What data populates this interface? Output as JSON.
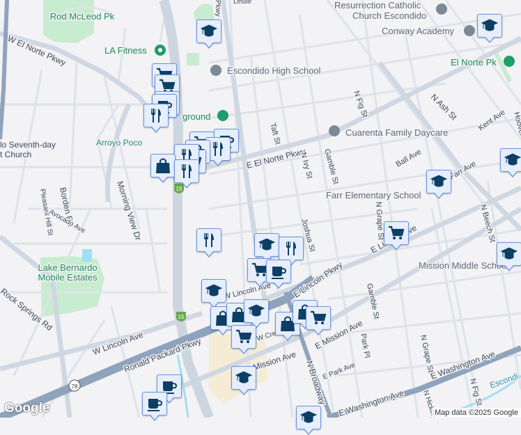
{
  "map": {
    "streets": {
      "w_el_norte": "W El Norte Pkwy",
      "e_el_norte": "E El Norte Pkwy",
      "morning_view": "Morning View Dr",
      "borden": "Borden Rd",
      "pleasant_hill": "Pleasant Hill St",
      "avocado": "Avocado Ave",
      "rock_springs": "Rock Springs Rd",
      "w_lincoln": "W Lincoln Ave",
      "w_lincoln2": "W Lincoln Ave",
      "e_lincoln_pkwy": "E Lincoln Pkwy",
      "e_lincoln_ave": "E Lincoln Ave",
      "ronald_packard": "Ronald Packard Pkwy",
      "mission": "Mission Ave",
      "e_mission": "E Mission Ave",
      "e_park": "E Park Ave",
      "park_pl": "Park Pl",
      "n_broadway": "N Broadway",
      "e_washington": "E Washington Ave",
      "e_washington2": "E Washington Ave",
      "taft": "Taft St",
      "n_ivy": "N Ivy St",
      "gamble": "Gamble St",
      "gamble2": "Gamble St",
      "joshua": "Joshua St",
      "n_fig": "N Fig St",
      "n_fig2": "N Fig St",
      "n_ash": "N Ash St",
      "kent": "Kent Ave",
      "ball": "Ball Ave",
      "farr": "Farr Ave",
      "n_grape": "N Grape St",
      "n_grape2": "N Grape St",
      "n_beech": "N Beech St",
      "hoover": "Hoover",
      "n_hickory": "N Hickory",
      "w_crest": "W Cre",
      "leslie": "Leslie",
      "pkwy": "Pkwy",
      "rt15": "15",
      "rt78": "78"
    },
    "places": {
      "rod_mcleod": "Rod McLeod Pk",
      "la_fitness": "LA Fitness",
      "escondido_high": "Escondido High School",
      "playground": "ground",
      "arroyo_poco": "Arroyo Poco",
      "seventh_day": "lo Seventh-day",
      "seventh_day2": "t Church",
      "resurrection": "Resurrection Catholic",
      "resurrection2": "Church Escondido",
      "conway": "Conway Academy",
      "el_norte_pk": "El Norte Pk",
      "cuarenta": "Cuarenta Family Daycare",
      "farr_elementary": "Farr Elementary School",
      "mission_middle": "Mission Middle School",
      "lake_bernardo": "Lake Bernardo",
      "lake_bernardo2": "Mobile Estates",
      "escondido_creek": "Escondi"
    },
    "markers": [
      {
        "type": "school"
      },
      {
        "type": "grocery"
      },
      {
        "type": "grocery"
      },
      {
        "type": "cafe"
      },
      {
        "type": "cafe"
      },
      {
        "type": "restaurant"
      },
      {
        "type": "grocery"
      },
      {
        "type": "cafe"
      },
      {
        "type": "restaurant"
      },
      {
        "type": "shopping"
      },
      {
        "type": "grocery"
      },
      {
        "type": "restaurant"
      },
      {
        "type": "shopping"
      },
      {
        "type": "restaurant"
      },
      {
        "type": "school"
      },
      {
        "type": "school"
      },
      {
        "type": "school"
      },
      {
        "type": "restaurant"
      },
      {
        "type": "school"
      },
      {
        "type": "restaurant"
      },
      {
        "type": "grocery"
      },
      {
        "type": "cafe"
      },
      {
        "type": "grocery"
      },
      {
        "type": "school"
      },
      {
        "type": "school"
      },
      {
        "type": "shopping"
      },
      {
        "type": "shopping"
      },
      {
        "type": "school"
      },
      {
        "type": "grocery"
      },
      {
        "type": "shopping"
      },
      {
        "type": "shopping"
      },
      {
        "type": "grocery"
      },
      {
        "type": "school"
      },
      {
        "type": "cafe"
      },
      {
        "type": "cafe"
      },
      {
        "type": "school"
      }
    ],
    "colors": {
      "marker_icon": "#0d3f64",
      "marker_bg": "#e6eefc",
      "marker_border": "#6b92dc",
      "park": "#c8ecd0",
      "freeway": "#8fa3bc"
    }
  },
  "footer": {
    "logo": "Google",
    "attribution": "Map data ©2025 Google"
  }
}
